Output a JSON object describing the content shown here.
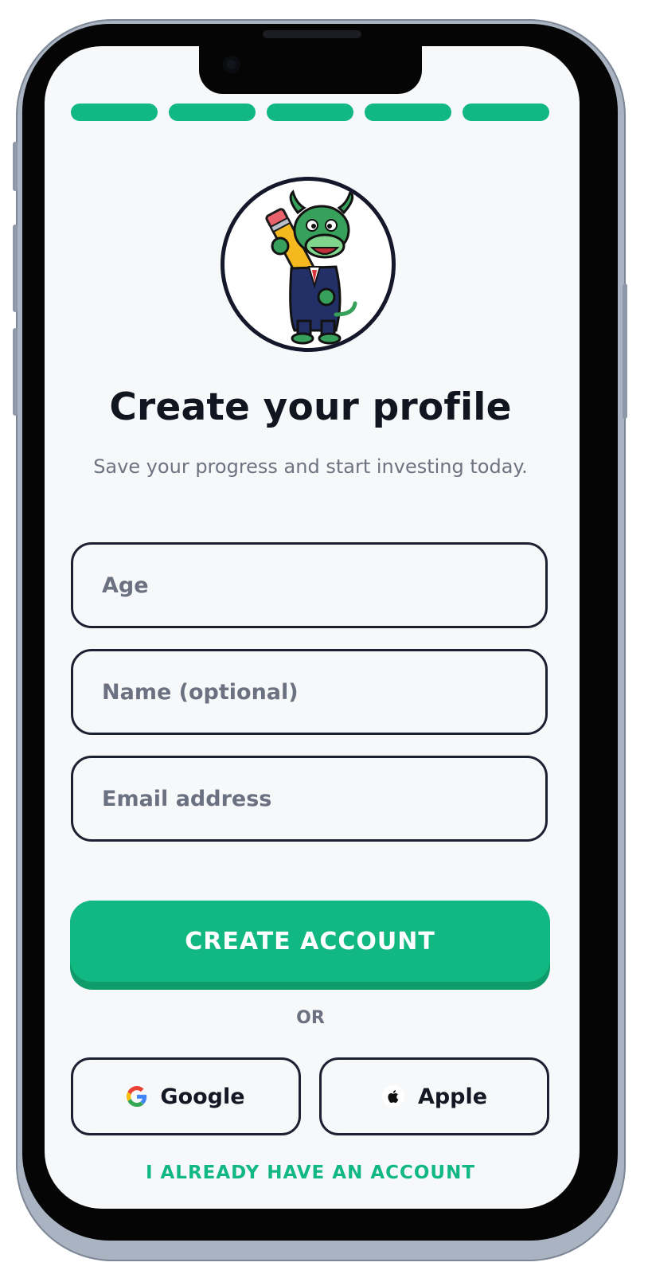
{
  "colors": {
    "accent": "#12b882",
    "accent_dark": "#0f9c6a",
    "text_dark": "#11151f",
    "text_muted": "#6d7380",
    "screen_bg": "#f7f8fa",
    "border": "#1c2030"
  },
  "progress": {
    "total_steps": 5,
    "completed_steps": 5
  },
  "avatar": {
    "icon": "bull-mascot-with-pencil"
  },
  "header": {
    "title": "Create your profile",
    "subtitle": "Save your progress and start investing today."
  },
  "form": {
    "age": {
      "placeholder": "Age",
      "value": ""
    },
    "name": {
      "placeholder": "Name (optional)",
      "value": ""
    },
    "email": {
      "placeholder": "Email address",
      "value": ""
    }
  },
  "actions": {
    "create_account_label": "CREATE ACCOUNT",
    "divider_label": "OR",
    "google_label": "Google",
    "google_icon": "google-g-icon",
    "apple_label": "Apple",
    "apple_icon": "apple-logo-icon",
    "login_link_label": "I ALREADY HAVE AN ACCOUNT"
  }
}
